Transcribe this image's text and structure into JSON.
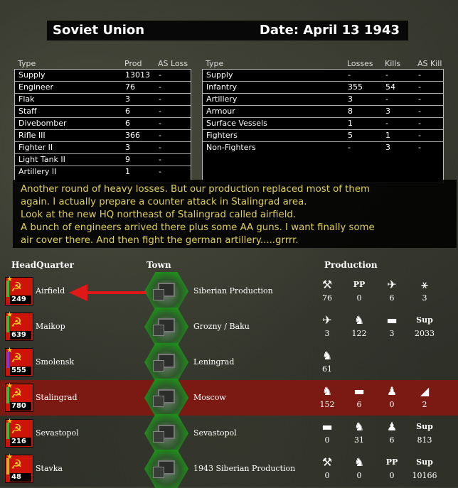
{
  "header": {
    "faction": "Soviet Union",
    "date": "Date: April 13 1943"
  },
  "production_table": {
    "headers": [
      "Type",
      "Prod",
      "AS Loss"
    ],
    "rows": [
      [
        "Supply",
        "13013",
        "-"
      ],
      [
        "Engineer",
        "76",
        "-"
      ],
      [
        "Flak",
        "3",
        "-"
      ],
      [
        "Staff",
        "6",
        "-"
      ],
      [
        "Divebomber",
        "6",
        "-"
      ],
      [
        "Rifle III",
        "366",
        "-"
      ],
      [
        "Fighter II",
        "3",
        "-"
      ],
      [
        "Light Tank II",
        "9",
        "-"
      ],
      [
        "Artillery II",
        "1",
        "-"
      ]
    ]
  },
  "losses_table": {
    "headers": [
      "Type",
      "Losses",
      "Kills",
      "AS Kill"
    ],
    "rows": [
      [
        "Supply",
        "-",
        "-",
        "-"
      ],
      [
        "Infantry",
        "355",
        "54",
        "-"
      ],
      [
        "Artillery",
        "3",
        "-",
        "-"
      ],
      [
        "Armour",
        "8",
        "3",
        "-"
      ],
      [
        "Surface Vessels",
        "1",
        "-",
        "-"
      ],
      [
        "Fighters",
        "5",
        "1",
        "-"
      ],
      [
        "Non-Fighters",
        "-",
        "3",
        "-"
      ]
    ]
  },
  "message": [
    "Another round of heavy losses. But our production replaced most of them",
    "again. I actually prepare a counter attack in Stalingrad area.",
    "Look at the new HQ northeast of Stalingrad called airfield.",
    "A bunch of engineers arrived there plus some AA guns. I want finally some",
    "air cover there. And then fight the german artillery.....grrrr."
  ],
  "columns": {
    "hq": "HeadQuarter",
    "town": "Town",
    "production": "Production"
  },
  "hq_rows": [
    {
      "name": "Airfield",
      "value": "249",
      "town": "Siberian Production",
      "selected": false,
      "bar_color": "#2fc040",
      "production": [
        {
          "icon": "engineer-icon",
          "label": "",
          "value": "76"
        },
        {
          "icon": "pp-icon",
          "label": "PP",
          "value": "0"
        },
        {
          "icon": "divebomber-icon",
          "label": "",
          "value": "6"
        },
        {
          "icon": "flak-icon",
          "label": "",
          "value": "3"
        }
      ]
    },
    {
      "name": "Maikop",
      "value": "639",
      "town": "Grozny / Baku",
      "selected": false,
      "bar_color": "#2fc040",
      "production": [
        {
          "icon": "fighter-icon",
          "label": "",
          "value": "3"
        },
        {
          "icon": "rifle-icon",
          "label": "",
          "value": "122"
        },
        {
          "icon": "light-tank-icon",
          "label": "",
          "value": "3"
        },
        {
          "icon": "supply-icon",
          "label": "Sup",
          "value": "2033"
        }
      ]
    },
    {
      "name": "Smolensk",
      "value": "555",
      "town": "Leningrad",
      "selected": false,
      "bar_color": "#7a3ad8",
      "production": [
        {
          "icon": "rifle-icon",
          "label": "",
          "value": "61"
        }
      ]
    },
    {
      "name": "Stalingrad",
      "value": "780",
      "town": "Moscow",
      "selected": true,
      "bar_color": "#2fc040",
      "production": [
        {
          "icon": "rifle-icon",
          "label": "",
          "value": "152"
        },
        {
          "icon": "light-tank-icon",
          "label": "",
          "value": "6"
        },
        {
          "icon": "staff-icon",
          "label": "",
          "value": "0"
        },
        {
          "icon": "artillery-icon",
          "label": "",
          "value": "2"
        }
      ]
    },
    {
      "name": "Sevastopol",
      "value": "216",
      "town": "Sevastopol",
      "selected": false,
      "bar_color": "#2fc040",
      "production": [
        {
          "icon": "light-tank-icon",
          "label": "",
          "value": "0"
        },
        {
          "icon": "rifle-icon",
          "label": "",
          "value": "31"
        },
        {
          "icon": "staff-icon",
          "label": "",
          "value": "6"
        },
        {
          "icon": "supply-icon",
          "label": "Sup",
          "value": "813"
        }
      ]
    },
    {
      "name": "Stavka",
      "value": "48",
      "town": "1943 Siberian Production",
      "selected": false,
      "bar_color": "#d8b020",
      "production": [
        {
          "icon": "engineer-icon",
          "label": "",
          "value": "0"
        },
        {
          "icon": "rifle-icon",
          "label": "",
          "value": "0"
        },
        {
          "icon": "pp-icon",
          "label": "PP",
          "value": "0"
        },
        {
          "icon": "supply-icon",
          "label": "Sup",
          "value": "10166"
        }
      ]
    }
  ],
  "colors": {
    "selected_row": "#7a1a12",
    "message_text": "#e0cf58",
    "annotation_arrow": "#e01818",
    "flag": "#cc1508"
  }
}
